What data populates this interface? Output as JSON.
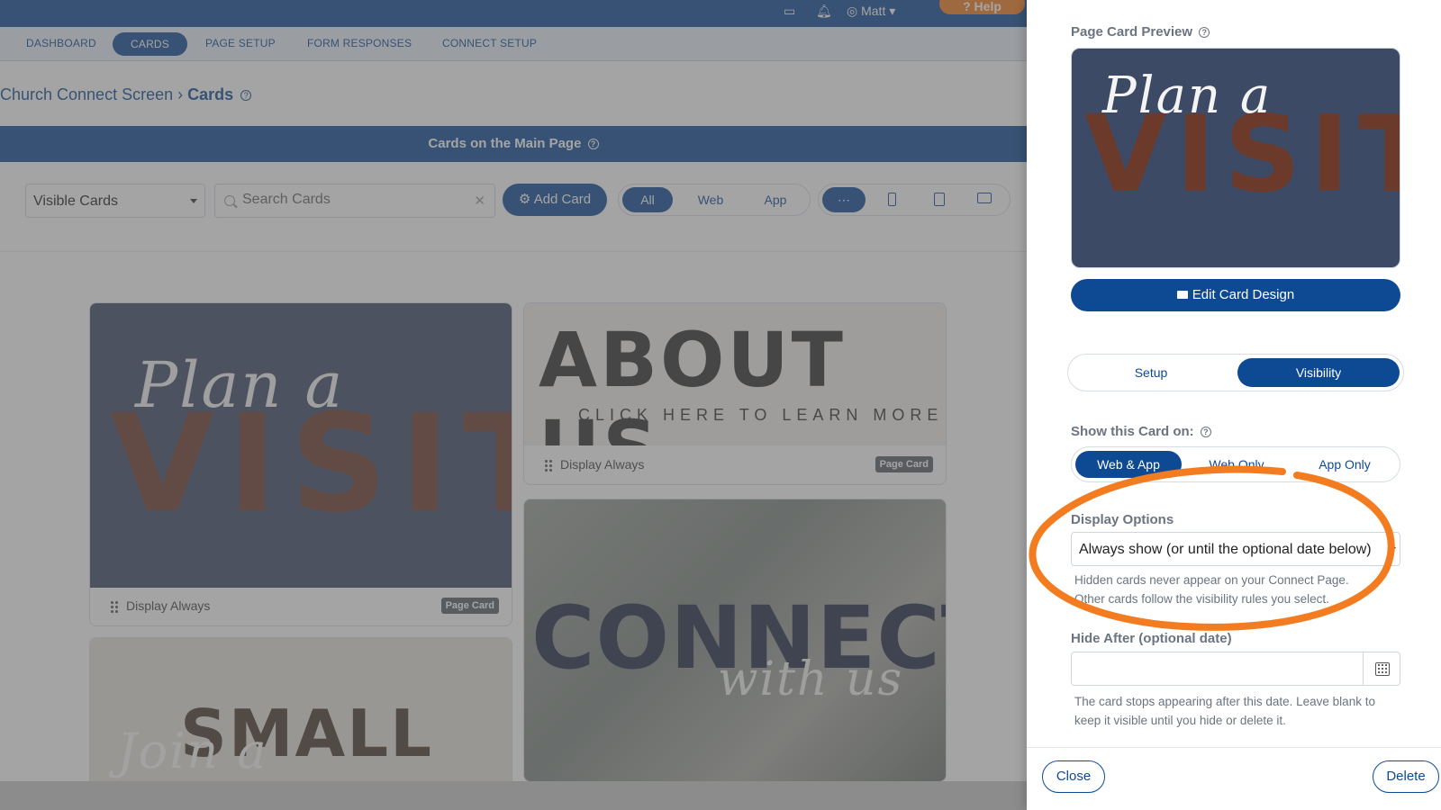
{
  "topbar": {
    "user": "Matt",
    "help": "Help"
  },
  "nav": {
    "items": [
      "DASHBOARD",
      "CARDS",
      "PAGE SETUP",
      "FORM RESPONSES",
      "CONNECT SETUP"
    ],
    "active": "CARDS"
  },
  "breadcrumb": {
    "parent": "Church Connect Screen",
    "current": "Cards"
  },
  "section": {
    "title": "Cards on the Main Page"
  },
  "toolbar": {
    "filter_value": "Visible Cards",
    "search_placeholder": "Search Cards",
    "add_label": "Add Card",
    "platform": [
      "All",
      "Web",
      "App"
    ],
    "platform_active": "All"
  },
  "cards": [
    {
      "art_script": "Plan a",
      "art_title": "VISIT",
      "footer": "Display Always",
      "tag": "Page Card"
    },
    {
      "art_title": "ABOUT US",
      "art_sub": "CLICK HERE TO LEARN MORE",
      "footer": "Display Always",
      "tag": "Page Card"
    },
    {
      "art_title": "CONNECT",
      "art_script": "with us"
    },
    {
      "art_title": "SMALL",
      "art_script": "Join a"
    }
  ],
  "panel": {
    "preview_label": "Page Card Preview",
    "preview_script": "Plan a",
    "preview_title": "VISIT",
    "edit_button": "Edit Card Design",
    "tabs": [
      "Setup",
      "Visibility"
    ],
    "tab_active": "Visibility",
    "show_label": "Show this Card on:",
    "show_options": [
      "Web & App",
      "Web Only",
      "App Only"
    ],
    "show_active": "Web & App",
    "display_label": "Display Options",
    "display_value": "Always show (or until the optional date below)",
    "display_hint_1": "Hidden cards never appear on your Connect Page.",
    "display_hint_2": "Other cards follow the visibility rules you select.",
    "hide_after_label": "Hide After (optional date)",
    "hide_after_value": "",
    "hide_hint_1": "The card stops appearing after this date. Leave blank to",
    "hide_hint_2": "keep it visible until you hide or delete it.",
    "close_button": "Close",
    "delete_button": "Delete"
  },
  "colors": {
    "brand": "#0e4a94",
    "annotation": "#f47c20",
    "card_art": "#3d4a66"
  }
}
